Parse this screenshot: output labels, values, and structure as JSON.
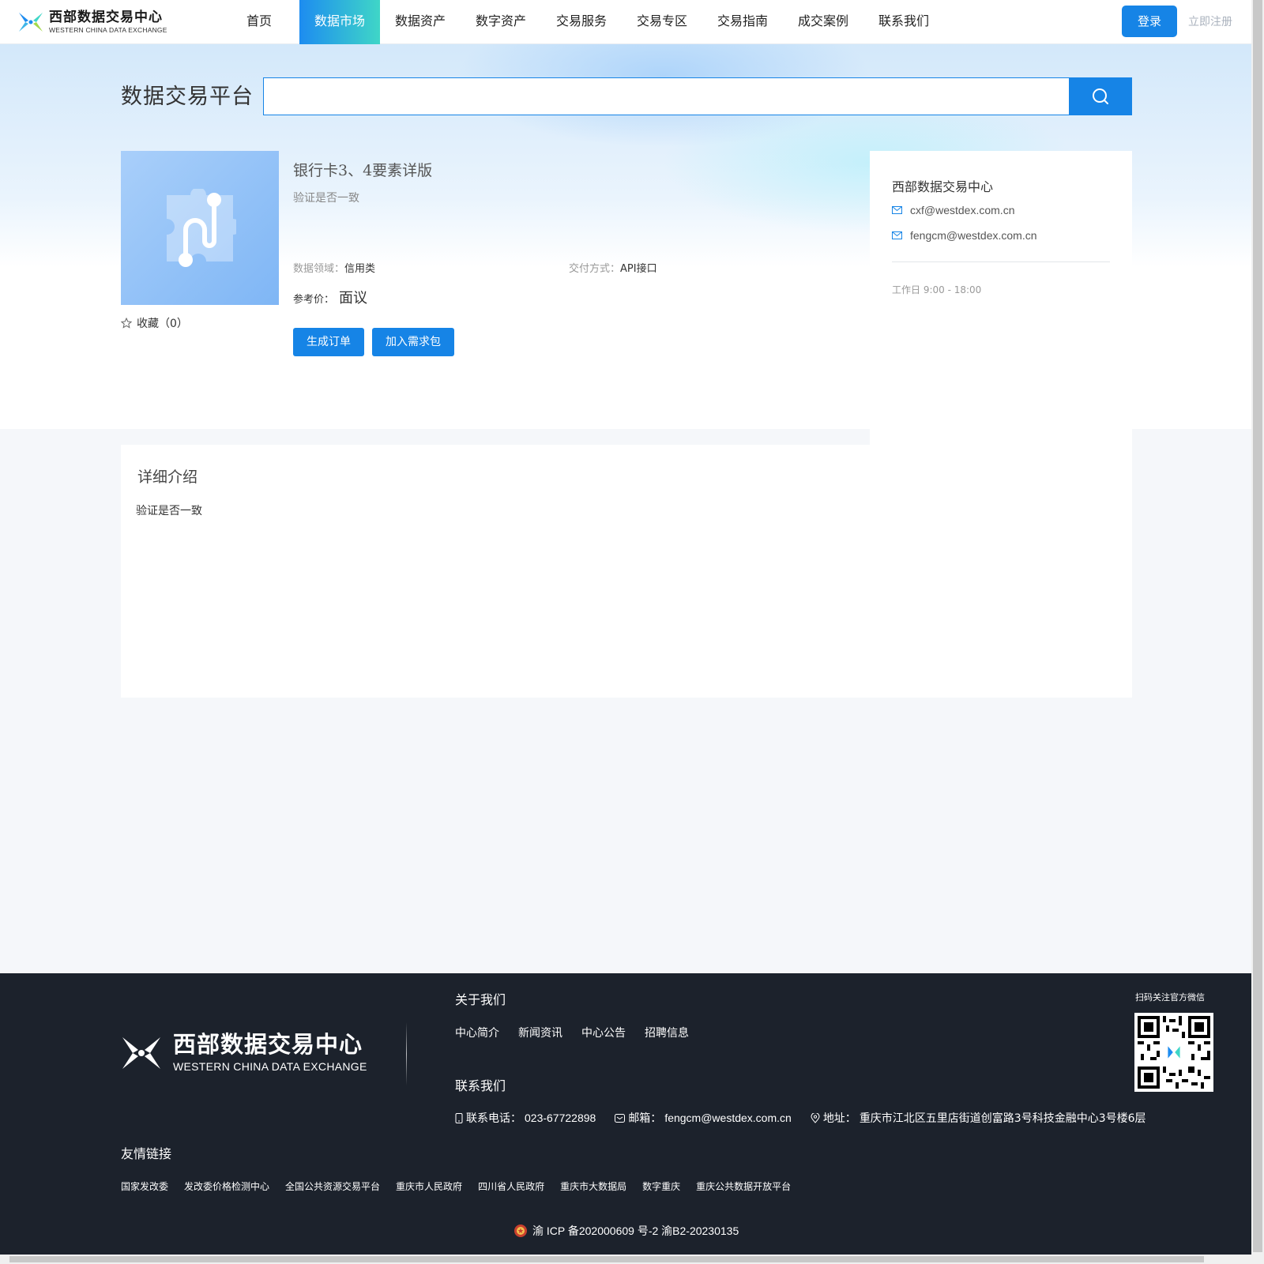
{
  "header": {
    "logo_cn": "西部数据交易中心",
    "logo_en": "WESTERN CHINA DATA EXCHANGE",
    "nav": [
      {
        "label": "首页",
        "active": false
      },
      {
        "label": "数据市场",
        "active": true
      },
      {
        "label": "数据资产",
        "active": false
      },
      {
        "label": "数字资产",
        "active": false
      },
      {
        "label": "交易服务",
        "active": false
      },
      {
        "label": "交易专区",
        "active": false
      },
      {
        "label": "交易指南",
        "active": false
      },
      {
        "label": "成交案例",
        "active": false
      },
      {
        "label": "联系我们",
        "active": false
      }
    ],
    "login_label": "登录",
    "register_label": "立即注册"
  },
  "search": {
    "platform_title": "数据交易平台",
    "value": "",
    "icon": "search-icon"
  },
  "product": {
    "title": "银行卡3、4要素详版",
    "subtitle": "验证是否一致",
    "domain_label": "数据领域：",
    "domain_value": "信用类",
    "delivery_label": "交付方式：",
    "delivery_value": "API接口",
    "price_label": "参考价：",
    "price_value": "面议",
    "favorite_label": "收藏（0）",
    "order_button": "生成订单",
    "package_button": "加入需求包"
  },
  "contact_card": {
    "name": "西部数据交易中心",
    "emails": [
      "cxf@westdex.com.cn",
      "fengcm@westdex.com.cn"
    ],
    "hours": "工作日 9:00 - 18:00"
  },
  "detail": {
    "title": "详细介绍",
    "body": "验证是否一致"
  },
  "footer": {
    "logo_cn": "西部数据交易中心",
    "logo_en": "WESTERN CHINA DATA EXCHANGE",
    "about_title": "关于我们",
    "about_links": [
      "中心简介",
      "新闻资讯",
      "中心公告",
      "招聘信息"
    ],
    "contact_title": "联系我们",
    "phone_label": "联系电话：",
    "phone": "023-67722898",
    "email_label": "邮箱：",
    "email": "fengcm@westdex.com.cn",
    "address_label": "地址：",
    "address": "重庆市江北区五里店街道创富路3号科技金融中心3号楼6层",
    "qr_label": "扫码关注官方微信",
    "friend_links_title": "友情链接",
    "friend_links": [
      "国家发改委",
      "发改委价格检测中心",
      "全国公共资源交易平台",
      "重庆市人民政府",
      "四川省人民政府",
      "重庆市大数据局",
      "数字重庆",
      "重庆公共数据开放平台"
    ],
    "icp": "渝 ICP 备202000609 号-2 渝B2-20230135"
  },
  "colors": {
    "accent": "#1684e6",
    "nav_active_start": "#1d8cf0",
    "nav_active_end": "#3fd6c7",
    "footer_bg": "#1c222c"
  }
}
